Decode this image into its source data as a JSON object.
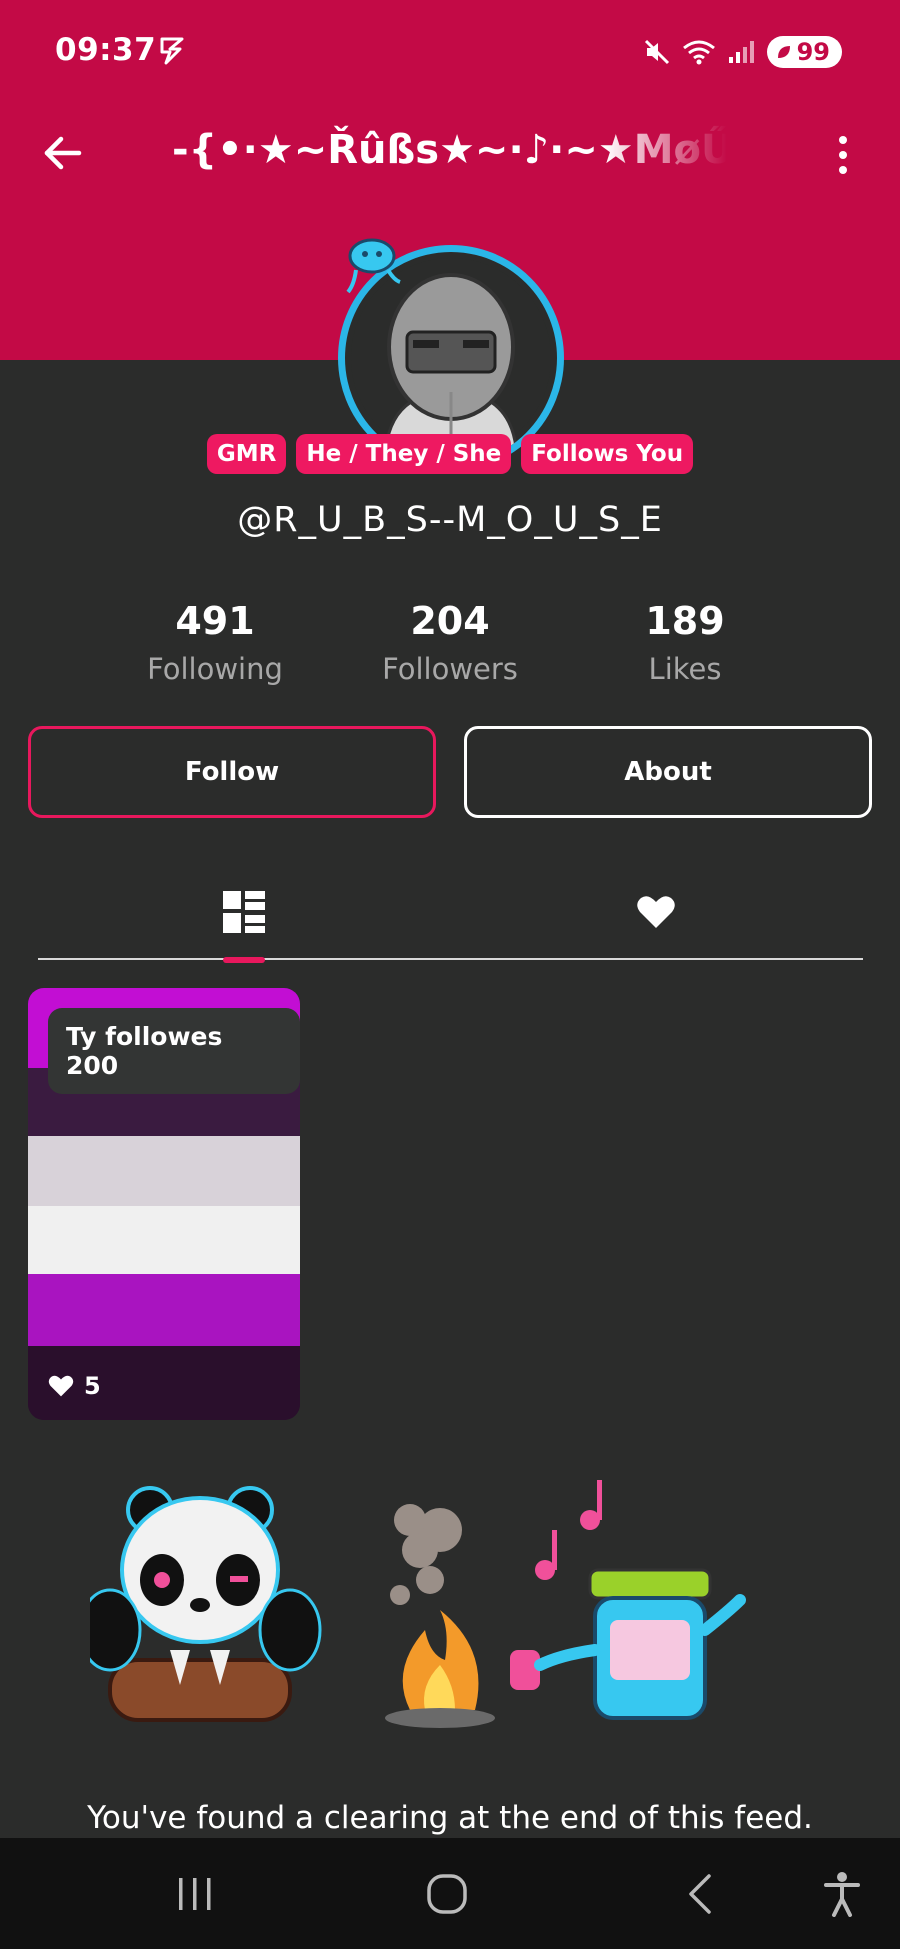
{
  "status_bar": {
    "time": "09:37",
    "battery": "99"
  },
  "header": {
    "title": "-{•·★~Řûßs★~·♪·~★MøŰS",
    "back_icon": "arrow-left-icon",
    "more_icon": "more-vert-icon"
  },
  "profile": {
    "badges": [
      "GMR",
      "He / They / She",
      "Follows You"
    ],
    "username": "@R_U_B_S--M_O_U_S_E",
    "stats": [
      {
        "value": "491",
        "label": "Following"
      },
      {
        "value": "204",
        "label": "Followers"
      },
      {
        "value": "189",
        "label": "Likes"
      }
    ]
  },
  "actions": {
    "follow_label": "Follow",
    "about_label": "About"
  },
  "tabs": [
    {
      "icon": "grid-icon",
      "active": true
    },
    {
      "icon": "heart-icon",
      "active": false
    }
  ],
  "posts": [
    {
      "label": "Ty followes 200",
      "likes": "5",
      "stripe_colors": [
        "#c20ed3",
        "#3a1b40",
        "#d8d2d9",
        "#f0f0f0",
        "#a914c0",
        "#2a0f2c"
      ]
    }
  ],
  "feed_end": {
    "text": "You've found a clearing at the end of this feed."
  },
  "colors": {
    "header": "#c30a46",
    "accent": "#e8185d",
    "background": "#2b2c2b",
    "avatar_ring": "#2bb6e8"
  }
}
